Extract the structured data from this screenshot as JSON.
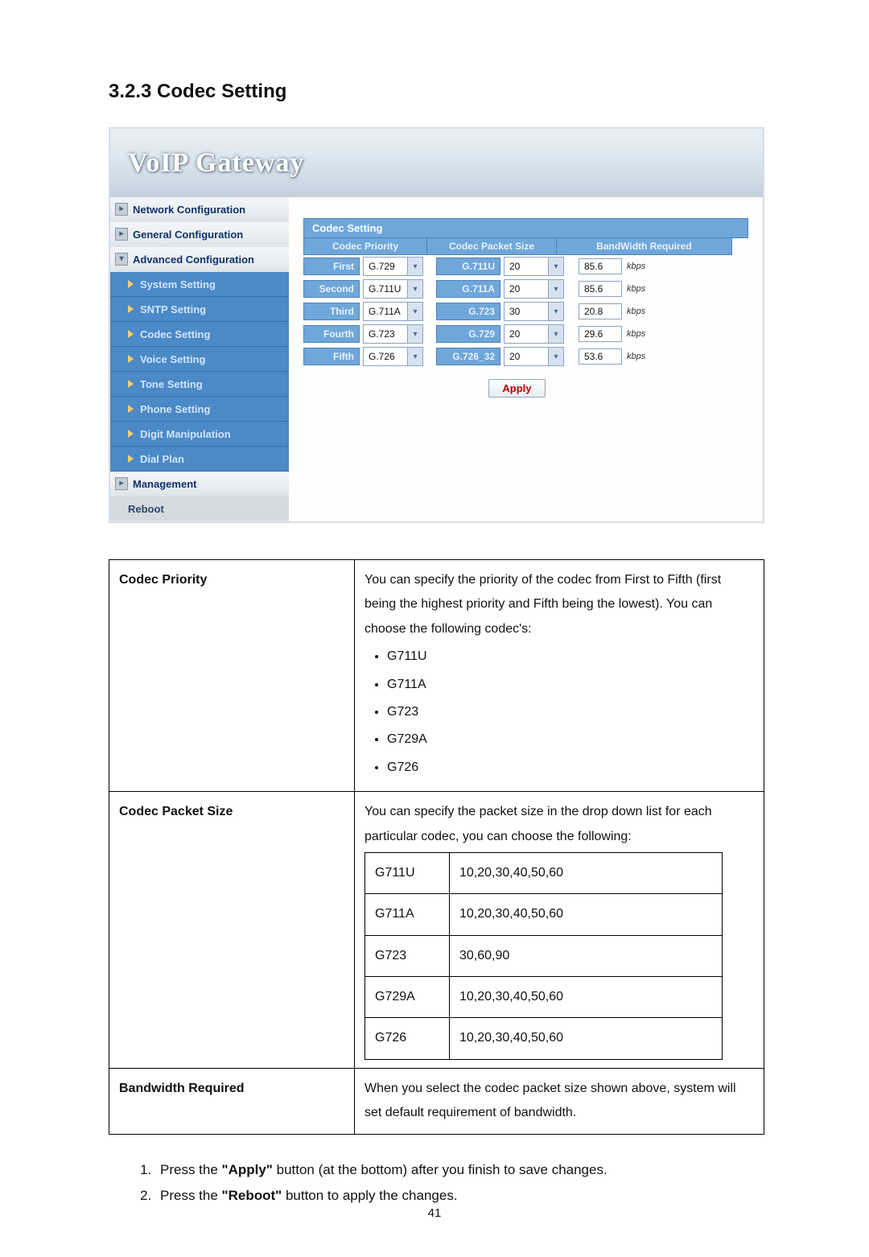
{
  "heading": "3.2.3   Codec Setting",
  "banner_title": "VoIP  Gateway",
  "sidebar": {
    "top": [
      {
        "label": "Network Configuration"
      },
      {
        "label": "General Configuration"
      },
      {
        "label": "Advanced Configuration"
      }
    ],
    "subs": [
      {
        "label": "System Setting"
      },
      {
        "label": "SNTP Setting"
      },
      {
        "label": "Codec Setting"
      },
      {
        "label": "Voice Setting"
      },
      {
        "label": "Tone Setting"
      },
      {
        "label": "Phone Setting"
      },
      {
        "label": "Digit Manipulation"
      },
      {
        "label": "Dial Plan"
      }
    ],
    "bottom": [
      {
        "label": "Management"
      }
    ],
    "reboot": "Reboot"
  },
  "panel": {
    "title": "Codec Setting",
    "header_priority": "Codec Priority",
    "header_packet": "Codec Packet Size",
    "header_bandwidth": "BandWidth Required",
    "rows": [
      {
        "ord": "First",
        "prio": "G.729",
        "ptype": "G.711U",
        "psize": "20",
        "bw": "85.6"
      },
      {
        "ord": "Second",
        "prio": "G.711U",
        "ptype": "G.711A",
        "psize": "20",
        "bw": "85.6"
      },
      {
        "ord": "Third",
        "prio": "G.711A",
        "ptype": "G.723",
        "psize": "30",
        "bw": "20.8"
      },
      {
        "ord": "Fourth",
        "prio": "G.723",
        "ptype": "G.729",
        "psize": "20",
        "bw": "29.6"
      },
      {
        "ord": "Fifth",
        "prio": "G.726",
        "ptype": "G.726_32",
        "psize": "20",
        "bw": "53.6"
      }
    ],
    "kbps": "kbps",
    "apply": "Apply"
  },
  "desc_table": {
    "row1": {
      "header": "Codec Priority",
      "intro": "You can specify the priority of the codec from First to Fifth (first being the highest priority and Fifth being the lowest).    You can choose the following codec's:",
      "codecs": [
        "G711U",
        "G711A",
        "G723",
        "G729A",
        "G726"
      ]
    },
    "row2": {
      "header": "Codec Packet Size",
      "intro": "You can specify the packet size in the drop down list for each particular codec, you can choose the following:",
      "table": [
        {
          "codec": "G711U",
          "vals": "10,20,30,40,50,60"
        },
        {
          "codec": "G711A",
          "vals": "10,20,30,40,50,60"
        },
        {
          "codec": "G723",
          "vals": "30,60,90"
        },
        {
          "codec": "G729A",
          "vals": "10,20,30,40,50,60"
        },
        {
          "codec": "G726",
          "vals": "10,20,30,40,50,60"
        }
      ]
    },
    "row3": {
      "header": "Bandwidth Required",
      "text": "When you select the codec packet size shown above, system will set default requirement of bandwidth."
    }
  },
  "steps": {
    "s1_pre": "Press the ",
    "s1_bold": "\"Apply\"",
    "s1_post": " button (at the bottom) after you finish to save changes.",
    "s2_pre": "Press the ",
    "s2_bold": "\"Reboot\"",
    "s2_post": " button to apply the changes."
  },
  "page_number": "41"
}
